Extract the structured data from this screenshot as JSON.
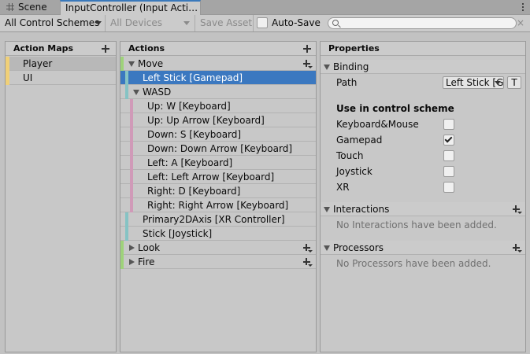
{
  "tabs": [
    {
      "label": "Scene",
      "icon": "grid-icon",
      "active": false
    },
    {
      "label": "InputController (Input Acti…",
      "active": true
    }
  ],
  "toolbar": {
    "control_schemes": "All Control Schemes",
    "devices": "All Devices",
    "save_asset": "Save Asset",
    "auto_save": "Auto-Save",
    "auto_save_checked": false,
    "search_placeholder": "",
    "clear_glyph": "×"
  },
  "action_maps": {
    "header": "Action Maps",
    "items": [
      {
        "label": "Player",
        "selected": true
      },
      {
        "label": "UI",
        "selected": false
      }
    ]
  },
  "actions": {
    "header": "Actions",
    "rows": [
      {
        "label": "Move",
        "kind": "action",
        "expanded": true
      },
      {
        "label": "Left Stick [Gamepad]",
        "kind": "binding",
        "selected": true
      },
      {
        "label": "WASD",
        "kind": "composite",
        "expanded": true
      },
      {
        "label": "Up: W [Keyboard]",
        "kind": "part"
      },
      {
        "label": "Up: Up Arrow [Keyboard]",
        "kind": "part"
      },
      {
        "label": "Down: S [Keyboard]",
        "kind": "part"
      },
      {
        "label": "Down: Down Arrow [Keyboard]",
        "kind": "part"
      },
      {
        "label": "Left: A [Keyboard]",
        "kind": "part"
      },
      {
        "label": "Left: Left Arrow [Keyboard]",
        "kind": "part"
      },
      {
        "label": "Right: D [Keyboard]",
        "kind": "part"
      },
      {
        "label": "Right: Right Arrow [Keyboard]",
        "kind": "part"
      },
      {
        "label": "Primary2DAxis [XR Controller]",
        "kind": "binding"
      },
      {
        "label": "Stick [Joystick]",
        "kind": "binding"
      },
      {
        "label": "Look",
        "kind": "action",
        "expanded": false
      },
      {
        "label": "Fire",
        "kind": "action",
        "expanded": false
      }
    ]
  },
  "properties": {
    "header": "Properties",
    "binding_section": "Binding",
    "path_label": "Path",
    "path_value": "Left Stick [Ga",
    "path_button": "T",
    "scheme_heading": "Use in control scheme",
    "schemes": [
      {
        "label": "Keyboard&Mouse",
        "checked": false
      },
      {
        "label": "Gamepad",
        "checked": true
      },
      {
        "label": "Touch",
        "checked": false
      },
      {
        "label": "Joystick",
        "checked": false
      },
      {
        "label": "XR",
        "checked": false
      }
    ],
    "interactions_section": "Interactions",
    "interactions_empty": "No Interactions have been added.",
    "processors_section": "Processors",
    "processors_empty": "No Processors have been added."
  },
  "colors": {
    "selection": "#3b78c0",
    "map_stripe": "#f0d078",
    "action_stripe": "#9ed27a",
    "binding_stripe": "#86c3c4",
    "part_stripe": "#d09ab8"
  }
}
